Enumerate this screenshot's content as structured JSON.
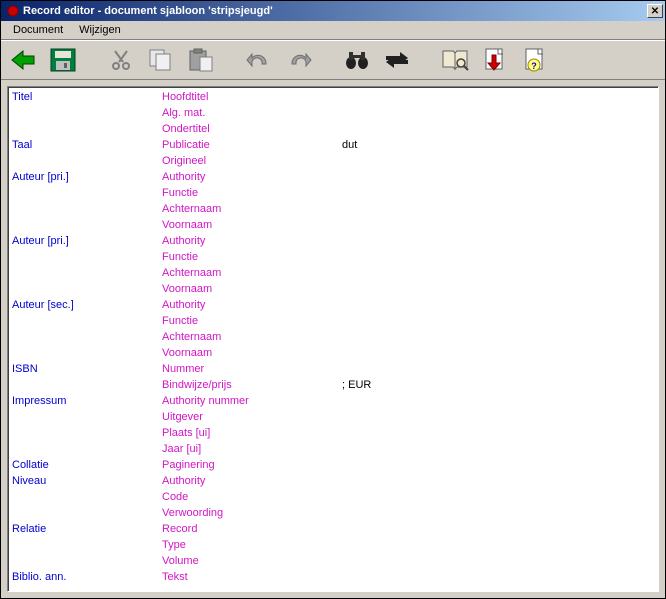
{
  "window": {
    "title": "Record editor - document sjabloon 'stripsjeugd'"
  },
  "menubar": {
    "document": "Document",
    "wijzigen": "Wijzigen"
  },
  "rows": [
    {
      "label": "Titel",
      "field": "Hoofdtitel",
      "value": ""
    },
    {
      "label": "",
      "field": "Alg. mat.",
      "value": ""
    },
    {
      "label": "",
      "field": "Ondertitel",
      "value": ""
    },
    {
      "label": "Taal",
      "field": "Publicatie",
      "value": "dut"
    },
    {
      "label": "",
      "field": "Origineel",
      "value": ""
    },
    {
      "label": "Auteur [pri.]",
      "field": "Authority",
      "value": ""
    },
    {
      "label": "",
      "field": "Functie",
      "value": ""
    },
    {
      "label": "",
      "field": "Achternaam",
      "value": ""
    },
    {
      "label": "",
      "field": "Voornaam",
      "value": ""
    },
    {
      "label": "Auteur [pri.]",
      "field": "Authority",
      "value": ""
    },
    {
      "label": "",
      "field": "Functie",
      "value": ""
    },
    {
      "label": "",
      "field": "Achternaam",
      "value": ""
    },
    {
      "label": "",
      "field": "Voornaam",
      "value": ""
    },
    {
      "label": "Auteur [sec.]",
      "field": "Authority",
      "value": ""
    },
    {
      "label": "",
      "field": "Functie",
      "value": ""
    },
    {
      "label": "",
      "field": "Achternaam",
      "value": ""
    },
    {
      "label": "",
      "field": "Voornaam",
      "value": ""
    },
    {
      "label": "ISBN",
      "field": "Nummer",
      "value": ""
    },
    {
      "label": "",
      "field": "Bindwijze/prijs",
      "value": "; EUR"
    },
    {
      "label": "Impressum",
      "field": "Authority nummer",
      "value": ""
    },
    {
      "label": "",
      "field": "Uitgever",
      "value": ""
    },
    {
      "label": "",
      "field": "Plaats [ui]",
      "value": ""
    },
    {
      "label": "",
      "field": "Jaar [ui]",
      "value": ""
    },
    {
      "label": "Collatie",
      "field": "Paginering",
      "value": ""
    },
    {
      "label": "Niveau",
      "field": "Authority",
      "value": ""
    },
    {
      "label": "",
      "field": "Code",
      "value": ""
    },
    {
      "label": "",
      "field": "Verwoording",
      "value": ""
    },
    {
      "label": "Relatie",
      "field": "Record",
      "value": ""
    },
    {
      "label": "",
      "field": "Type",
      "value": ""
    },
    {
      "label": "",
      "field": "Volume",
      "value": ""
    },
    {
      "label": "Biblio. ann.",
      "field": "Tekst",
      "value": ""
    }
  ]
}
